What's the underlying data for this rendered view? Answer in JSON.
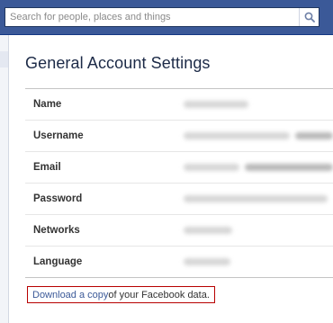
{
  "search": {
    "placeholder": "Search for people, places and things"
  },
  "page": {
    "title": "General Account Settings"
  },
  "settings": {
    "rows": [
      {
        "label": "Name"
      },
      {
        "label": "Username"
      },
      {
        "label": "Email"
      },
      {
        "label": "Password"
      },
      {
        "label": "Networks"
      },
      {
        "label": "Language"
      }
    ]
  },
  "download": {
    "link_text": "Download a copy",
    "rest_text": " of your Facebook data."
  },
  "colors": {
    "header_blue": "#3b5998",
    "highlight_border": "#b80000"
  },
  "icons": {
    "search": "magnifier"
  }
}
